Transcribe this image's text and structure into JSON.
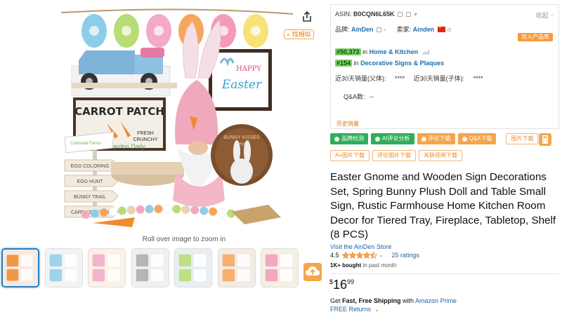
{
  "image_viewer": {
    "zoom_hint": "Roll over image to zoom in",
    "find_similar_label": "找相似",
    "main_image": {
      "egg_banner_count": 6,
      "sign_left_text": "CARROT PATCH",
      "sign_left_sub1": "FRESH",
      "sign_left_sub2": "CRUNCHY",
      "sign_left_script": "Garden Daily",
      "sign_right_line1": "HAPPY",
      "sign_right_line2": "Easter",
      "round_sign_text": "BUNNY KISSES",
      "round_sign_sub": "25¢",
      "arrow_signs": [
        "EGG COLORING",
        "EGG HUNT",
        "BUNNY TRAIL",
        "CARROT PATCH"
      ],
      "arrow_sign_top": "Cottontail Farms"
    },
    "thumbnails": [
      {
        "label": "thumb-1",
        "active": true
      },
      {
        "label": "thumb-2",
        "active": false
      },
      {
        "label": "thumb-3",
        "active": false
      },
      {
        "label": "thumb-4",
        "active": false
      },
      {
        "label": "thumb-5",
        "active": false
      },
      {
        "label": "thumb-6",
        "active": false
      },
      {
        "label": "thumb-7",
        "active": false
      }
    ]
  },
  "plugin": {
    "asin_label": "ASIN:",
    "asin_value": "B0CQN6L65K",
    "collapse_label": "收起",
    "brand_label": "品牌:",
    "brand_value": "AinDen",
    "seller_label": "卖家:",
    "seller_value": "Ainden",
    "add_product_label": "加入产品库",
    "ranks": [
      {
        "rank": "#50,373",
        "in": "in",
        "category": "Home & Kitchen"
      },
      {
        "rank": "#154",
        "in": "in",
        "category": "Decorative Signs & Plaques"
      }
    ],
    "sales_parent_label": "近30天销量(父体):",
    "sales_parent_value": "****",
    "sales_child_label": "近30天销量(子体):",
    "sales_child_value": "****",
    "qa_label": "Q&A数:",
    "qa_value": "--",
    "history_label": "历史销量"
  },
  "tools": {
    "row1": [
      "品牌检测",
      "AI评论分析",
      "评论下载",
      "Q&A下载",
      "图片下载"
    ],
    "row2": [
      "A+图片下载",
      "评论图片下载",
      "关联视频下载"
    ]
  },
  "product": {
    "title": "Easter Gnome and Wooden Sign Decorations Set, Spring Bunny Plush Doll and Table Small Sign, Rustic Farmhouse Home Kitchen Room Decor for Tiered Tray, Fireplace, Tabletop, Shelf (8 PCS)",
    "store_link": "Visit the AinDen Store",
    "rating_value": "4.5",
    "rating_stars": 4.5,
    "ratings_count": "25 ratings",
    "bought_bold": "1K+ bought",
    "bought_rest": " in past month",
    "price_symbol": "$",
    "price_whole": "16",
    "price_fraction": "99",
    "shipping_prefix": "Get ",
    "shipping_bold": "Fast, Free Shipping",
    "shipping_mid": " with ",
    "shipping_prime": "Amazon Prime",
    "returns_label": "FREE Returns"
  },
  "colors": {
    "accent_orange": "#f5a54a",
    "green_button": "#2fae5a",
    "link_blue": "#2162a1",
    "star_orange": "#f3a847",
    "rank_green": "#7fcf6a"
  }
}
